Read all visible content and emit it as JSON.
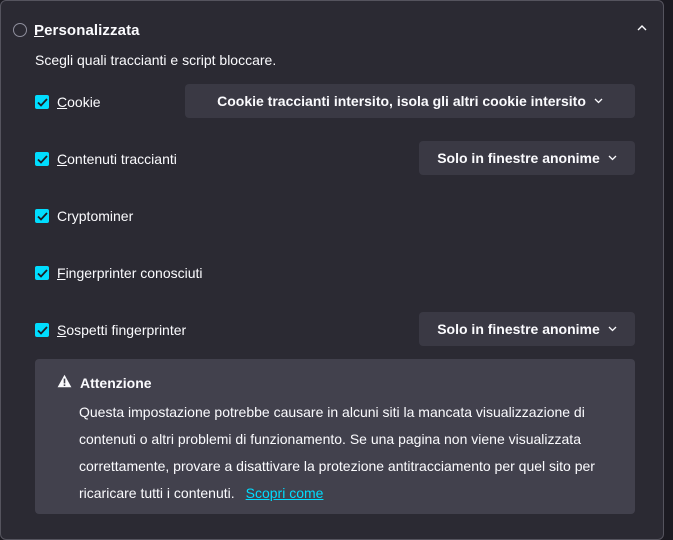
{
  "section": {
    "title": "Personalizzata",
    "subtitle": "Scegli quali traccianti e script bloccare."
  },
  "options": [
    {
      "label": "Cookie",
      "checked": true
    },
    {
      "label": "Contenuti traccianti",
      "checked": true
    },
    {
      "label": "Cryptominer",
      "checked": true
    },
    {
      "label": "Fingerprinter conosciuti",
      "checked": true
    },
    {
      "label": "Sospetti fingerprinter",
      "checked": true
    }
  ],
  "selects": {
    "cookie": "Cookie traccianti intersito, isola gli altri cookie intersito",
    "tracking_content": "Solo in finestre anonime",
    "suspected_fingerprinters": "Solo in finestre anonime"
  },
  "warning": {
    "title": "Attenzione",
    "body": "Questa impostazione potrebbe causare in alcuni siti la mancata visualizzazione di contenuti o altri problemi di funzionamento. Se una pagina non viene visualizzata correttamente, provare a disattivare la protezione antitracciamento per quel sito per ricaricare tutti i contenuti.",
    "link": "Scopri come"
  },
  "colors": {
    "accent": "#00ddff",
    "panel_bg": "#2b2a33",
    "control_bg": "#3a3944",
    "warning_bg": "#42414d"
  }
}
